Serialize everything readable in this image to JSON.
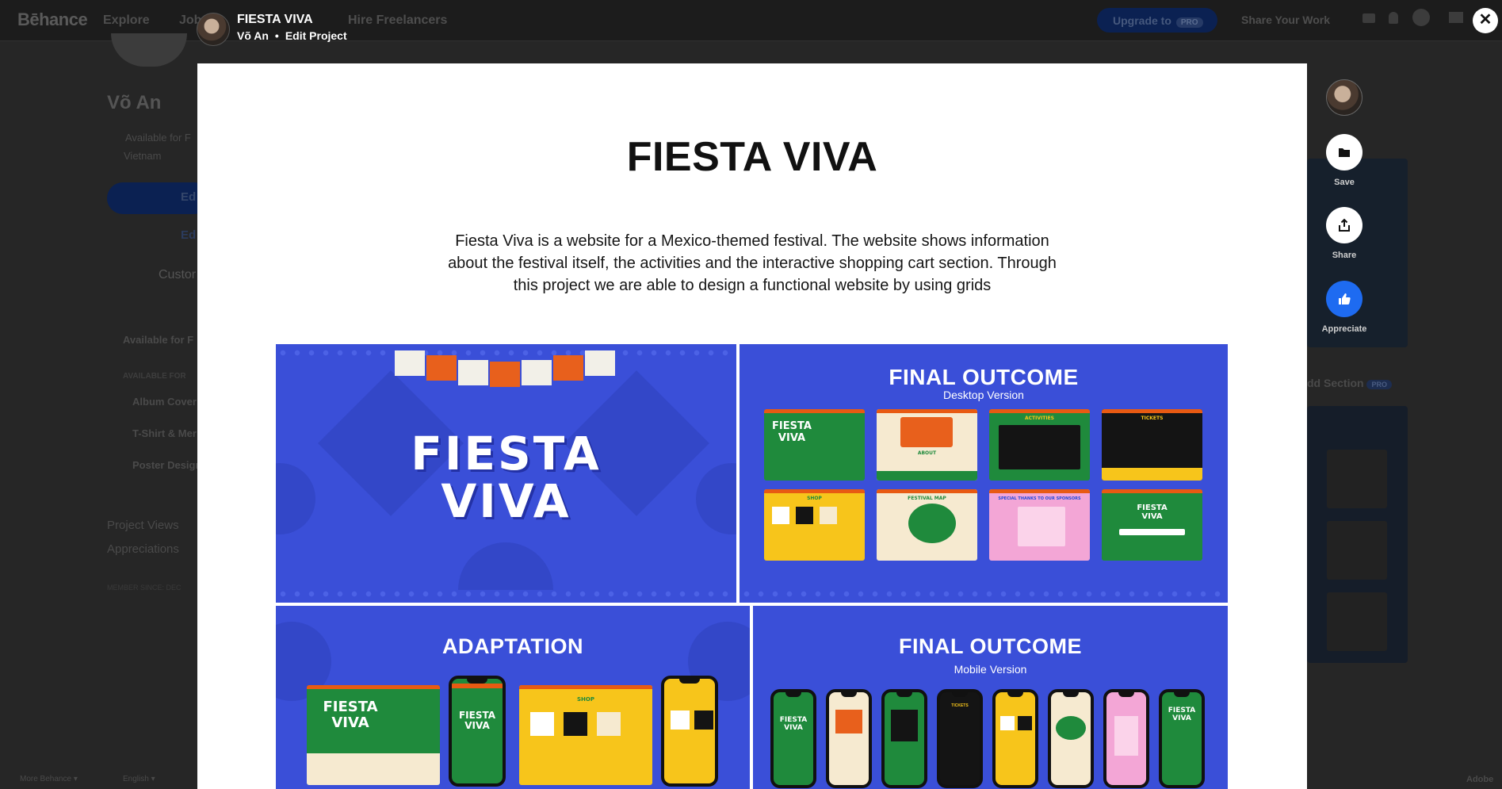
{
  "background": {
    "brand": "Bēhance",
    "nav": [
      "Explore",
      "Jobs",
      "Hire Freelancers"
    ],
    "upgrade_label": "Upgrade to",
    "upgrade_badge": "PRO",
    "share_work": "Share Your Work",
    "profile_name": "Võ An",
    "available_for": "Available for F",
    "location": "Vietnam",
    "edit_label": "Ed",
    "edit_label2": "Ed",
    "customize": "Custor",
    "available_for_heading": "Available for F",
    "available_for_caps": "AVAILABLE FOR",
    "services": [
      "Album Cover",
      "T-Shirt & Mer",
      "Poster Design"
    ],
    "project_views": "Project Views",
    "appreciations": "Appreciations",
    "member_since": "MEMBER SINCE: DEC",
    "add_section": "dd Section",
    "add_section_badge": "PRO",
    "footer_more": "More Behance ▾",
    "footer_lang": "English ▾",
    "footer_adobe": "Adobe"
  },
  "project_header": {
    "title": "FIESTA VIVA",
    "owner": "Võ An",
    "separator": "•",
    "edit_link": "Edit Project",
    "close": "✕"
  },
  "project": {
    "title": "FIESTA VIVA",
    "description": "Fiesta Viva is a website for a Mexico-themed festival. The website shows information about the festival itself, the activities and the interactive shopping cart section. Through this project we are able to design a functional website by using grids"
  },
  "tiles": {
    "cover_line1": "FIESTA",
    "cover_line2": "VIVA",
    "desktop_title": "FINAL OUTCOME",
    "desktop_sub": "Desktop Version",
    "adaptation_title": "ADAPTATION",
    "mobile_title": "FINAL OUTCOME",
    "mobile_sub": "Mobile Version",
    "mini_logo": "FIESTA VIVA",
    "mini_labels": [
      "ABOUT",
      "ACTIVITIES",
      "TICKETS",
      "SHOP",
      "FESTIVAL MAP",
      "SPECIAL THANKS TO OUR SPONSORS",
      "FIESTA VIVA"
    ]
  },
  "actions": {
    "save": "Save",
    "share": "Share",
    "appreciate": "Appreciate"
  },
  "colors": {
    "tile_blue": "#3a4fd8",
    "screen_green": "#1f8a3c",
    "screen_yellow": "#f7c51b",
    "screen_cream": "#f6ead0",
    "screen_black": "#141414",
    "screen_pink": "#f3a6d6",
    "nav_orange": "#e85a12",
    "appreciate_blue": "#1e6bf1"
  }
}
